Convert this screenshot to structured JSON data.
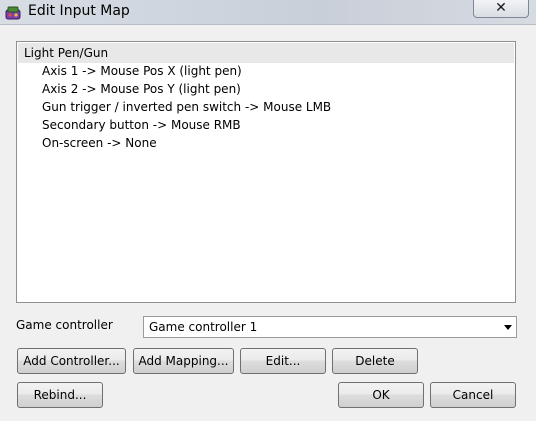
{
  "window": {
    "title": "Edit Input Map",
    "close_label": "✕"
  },
  "list": {
    "header": "Light Pen/Gun",
    "items": [
      "Axis 1 -> Mouse Pos X (light pen)",
      "Axis 2 -> Mouse Pos Y (light pen)",
      "Gun trigger / inverted pen switch -> Mouse LMB",
      "Secondary button -> Mouse RMB",
      "On-screen -> None"
    ]
  },
  "controller": {
    "label": "Game controller",
    "selected": "Game controller 1"
  },
  "buttons": {
    "add_controller": "Add Controller...",
    "add_mapping": "Add Mapping...",
    "edit": "Edit...",
    "delete": "Delete",
    "rebind": "Rebind...",
    "ok": "OK",
    "cancel": "Cancel"
  }
}
